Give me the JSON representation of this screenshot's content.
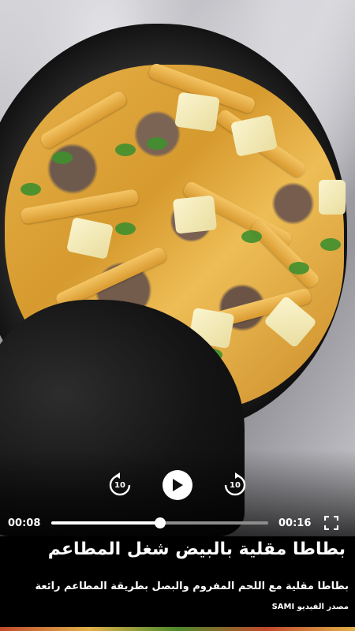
{
  "player": {
    "current_time": "00:08",
    "total_time": "00:16",
    "progress": 0.5,
    "skip_back_label": "10",
    "skip_forward_label": "10"
  },
  "video": {
    "title": "بطاطا مقلية بالبيض شغل المطاعم",
    "subtitle": "بطاطا مقلية مع اللحم المفروم والبصل بطريقة المطاعم رائعة",
    "source_text": "مصدر الفيديو SAMI"
  },
  "icons": {
    "skip_back": "replay-10-icon",
    "play": "play-icon",
    "skip_forward": "forward-10-icon",
    "fullscreen": "fullscreen-icon"
  }
}
